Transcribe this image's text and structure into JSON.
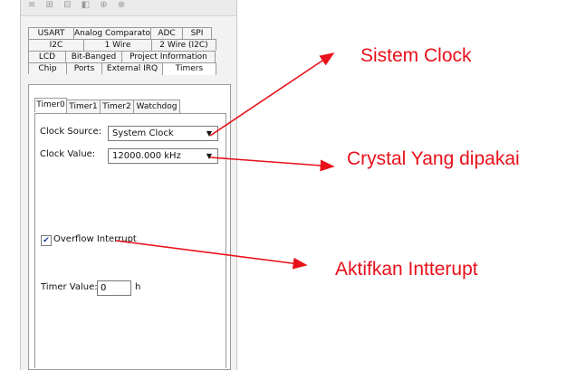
{
  "toolbar": {
    "glyphs": "≡ ⊞ ⊟ ◧ ⊕ ⊗"
  },
  "tabs": {
    "row1": [
      "USART",
      "Analog Comparator",
      "ADC",
      "SPI"
    ],
    "row2": [
      "I2C",
      "1 Wire",
      "2 Wire (I2C)"
    ],
    "row3": [
      "LCD",
      "Bit-Banged",
      "Project Information"
    ],
    "row4": [
      "Chip",
      "Ports",
      "External IRQ",
      "Timers"
    ],
    "active": "Timers"
  },
  "subtabs": {
    "items": [
      "Timer0",
      "Timer1",
      "Timer2",
      "Watchdog"
    ],
    "active": "Timer0"
  },
  "form": {
    "clock_source_label": "Clock Source:",
    "clock_source_value": "System Clock",
    "clock_value_label": "Clock Value:",
    "clock_value_value": "12000.000 kHz",
    "overflow_label": "Overflow Interrupt",
    "overflow_checked": true,
    "timer_value_label": "Timer Value:",
    "timer_value_value": "0",
    "timer_value_unit": "h"
  },
  "annotations": {
    "sistem_clock": "Sistem Clock",
    "crystal": "Crystal Yang dipakai",
    "interrupt": "Aktifkan Intterupt",
    "color": "#e8101a"
  }
}
